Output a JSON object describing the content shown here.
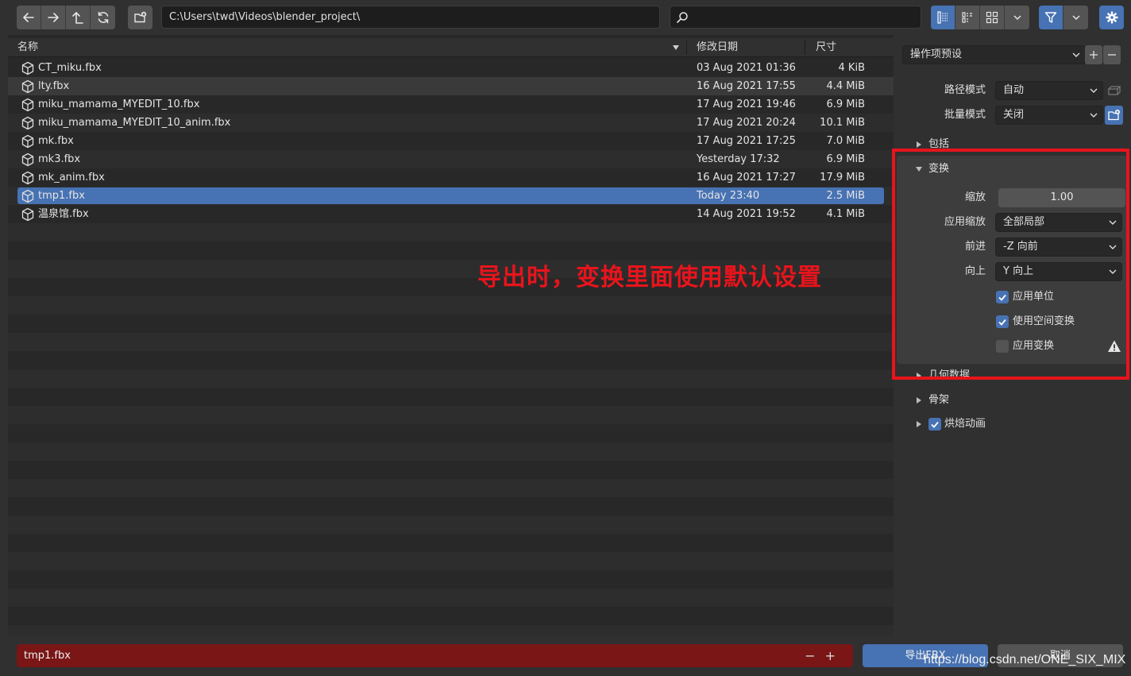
{
  "toolbar": {
    "path": "C:\\Users\\twd\\Videos\\blender_project\\",
    "search_placeholder": ""
  },
  "file_list": {
    "columns": {
      "name": "名称",
      "date": "修改日期",
      "size": "尺寸"
    },
    "files": [
      {
        "name": "CT_miku.fbx",
        "date": "03 Aug 2021 01:36",
        "size": "4 KiB"
      },
      {
        "name": "lty.fbx",
        "date": "16 Aug 2021 17:55",
        "size": "4.4 MiB"
      },
      {
        "name": "miku_mamama_MYEDIT_10.fbx",
        "date": "17 Aug 2021 19:46",
        "size": "6.9 MiB"
      },
      {
        "name": "miku_mamama_MYEDIT_10_anim.fbx",
        "date": "17 Aug 2021 20:24",
        "size": "10.1 MiB"
      },
      {
        "name": "mk.fbx",
        "date": "17 Aug 2021 17:25",
        "size": "7.0 MiB"
      },
      {
        "name": "mk3.fbx",
        "date": "Yesterday 17:32",
        "size": "6.9 MiB"
      },
      {
        "name": "mk_anim.fbx",
        "date": "16 Aug 2021 17:27",
        "size": "17.9 MiB"
      },
      {
        "name": "tmp1.fbx",
        "date": "Today 23:40",
        "size": "2.5 MiB"
      },
      {
        "name": "温泉馆.fbx",
        "date": "14 Aug 2021 19:52",
        "size": "4.1 MiB"
      }
    ],
    "selected_index": 7,
    "hover_index": 1
  },
  "side_panel": {
    "preset_label": "操作项预设",
    "path_mode_label": "路径模式",
    "path_mode_value": "自动",
    "batch_mode_label": "批量模式",
    "batch_mode_value": "关闭",
    "include_header": "包括",
    "transform_header": "变换",
    "scale_label": "缩放",
    "scale_value": "1.00",
    "apply_scalings_label": "应用缩放",
    "apply_scalings_value": "全部局部",
    "forward_label": "前进",
    "forward_value": "-Z 向前",
    "up_label": "向上",
    "up_value": "Y 向上",
    "apply_unit_label": "应用单位",
    "apply_unit_checked": true,
    "space_transform_label": "使用空间变换",
    "space_transform_checked": true,
    "apply_transform_label": "应用变换",
    "apply_transform_checked": false,
    "geometry_header": "几何数据",
    "armature_header": "骨架",
    "bake_anim_header": "烘焙动画",
    "bake_anim_checked": true
  },
  "annotation": {
    "text": "导出时，变换里面使用默认设置",
    "color": "#e8141c"
  },
  "bottom": {
    "filename": "tmp1.fbx",
    "minus": "−",
    "plus": "+",
    "export_label": "导出FBX",
    "cancel_label": "取消"
  },
  "watermark": "https://blog.csdn.net/ONE_SIX_MIX",
  "colors": {
    "accent": "#4772b3",
    "filename_bg": "#7a1616"
  }
}
